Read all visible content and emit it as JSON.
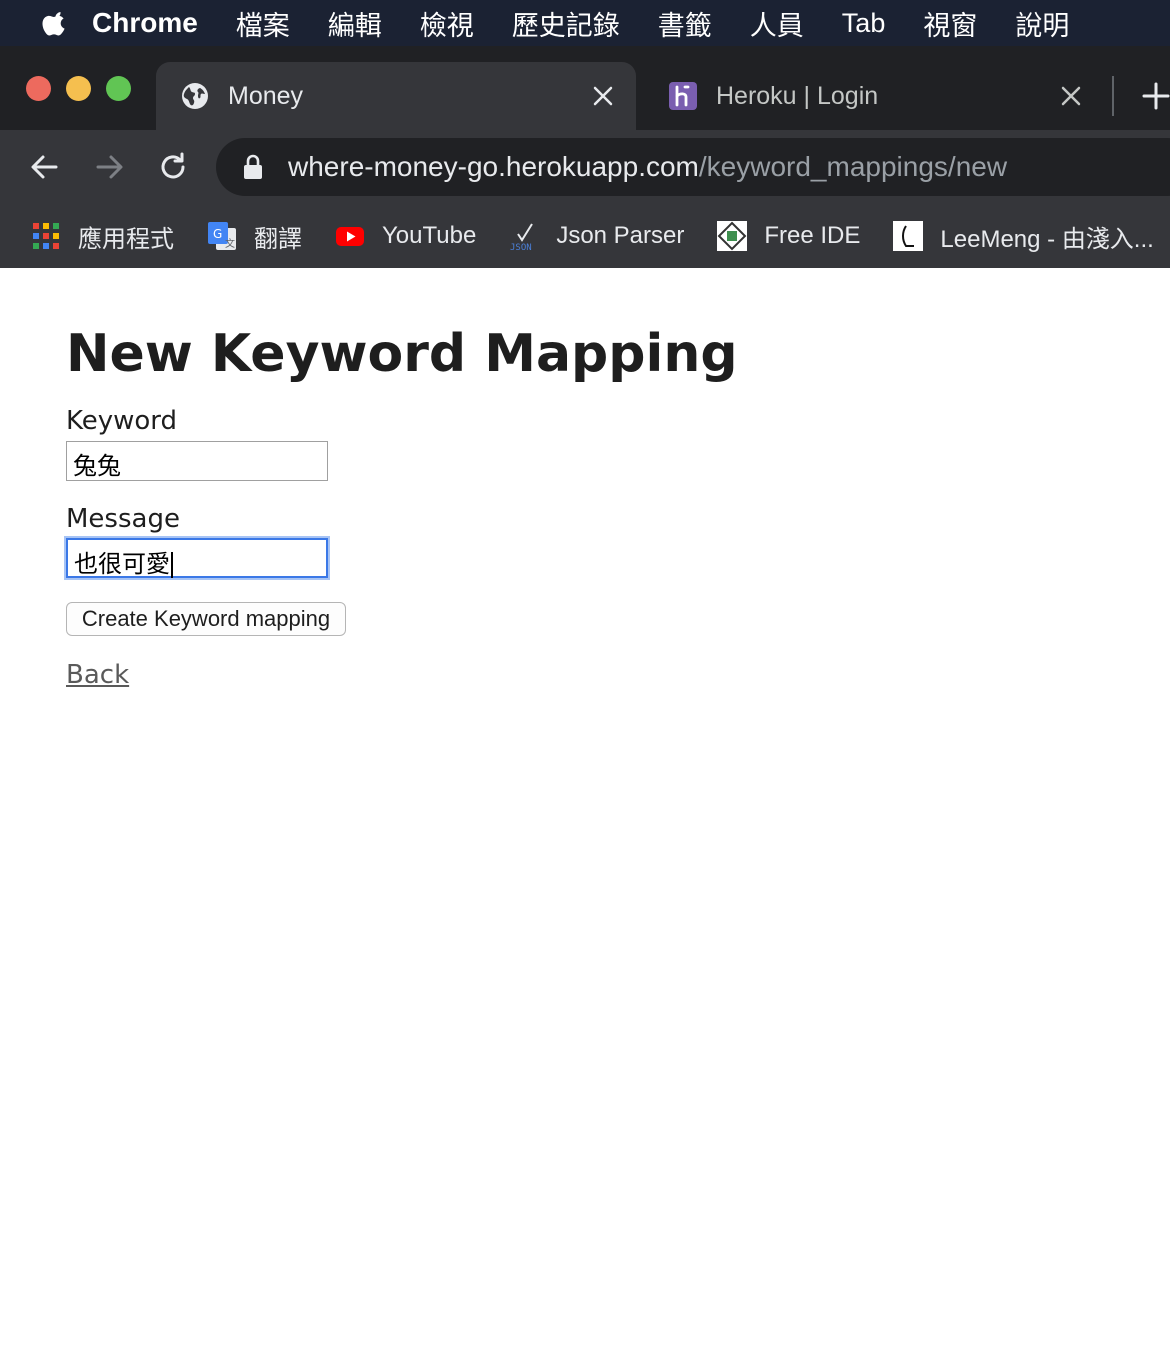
{
  "menubar": {
    "app_name": "Chrome",
    "items": [
      "檔案",
      "編輯",
      "檢視",
      "歷史記錄",
      "書籤",
      "人員",
      "Tab",
      "視窗",
      "說明"
    ]
  },
  "tabs": [
    {
      "title": "Money",
      "icon": "globe-icon",
      "active": true
    },
    {
      "title": "Heroku | Login",
      "icon": "heroku-icon",
      "active": false
    }
  ],
  "address_bar": {
    "host": "where-money-go.herokuapp.com",
    "path": "/keyword_mappings/new"
  },
  "bookmarks": [
    {
      "label": "應用程式",
      "icon": "apps-grid-icon"
    },
    {
      "label": "翻譯",
      "icon": "google-translate-icon"
    },
    {
      "label": "YouTube",
      "icon": "youtube-icon"
    },
    {
      "label": "Json Parser",
      "icon": "json-icon"
    },
    {
      "label": "Free IDE",
      "icon": "ide-icon"
    },
    {
      "label": "LeeMeng - 由淺入...",
      "icon": "leemeng-icon"
    }
  ],
  "colors": {
    "menubar_bg": "#1b2233",
    "tab_strip_bg": "#202124",
    "toolbar_bg": "#35363a",
    "focus_ring": "#3b78e7"
  },
  "page": {
    "heading": "New Keyword Mapping",
    "keyword_label": "Keyword",
    "keyword_value": "兔兔",
    "message_label": "Message",
    "message_value": "也很可愛",
    "submit_label": "Create Keyword mapping",
    "back_link": "Back"
  }
}
